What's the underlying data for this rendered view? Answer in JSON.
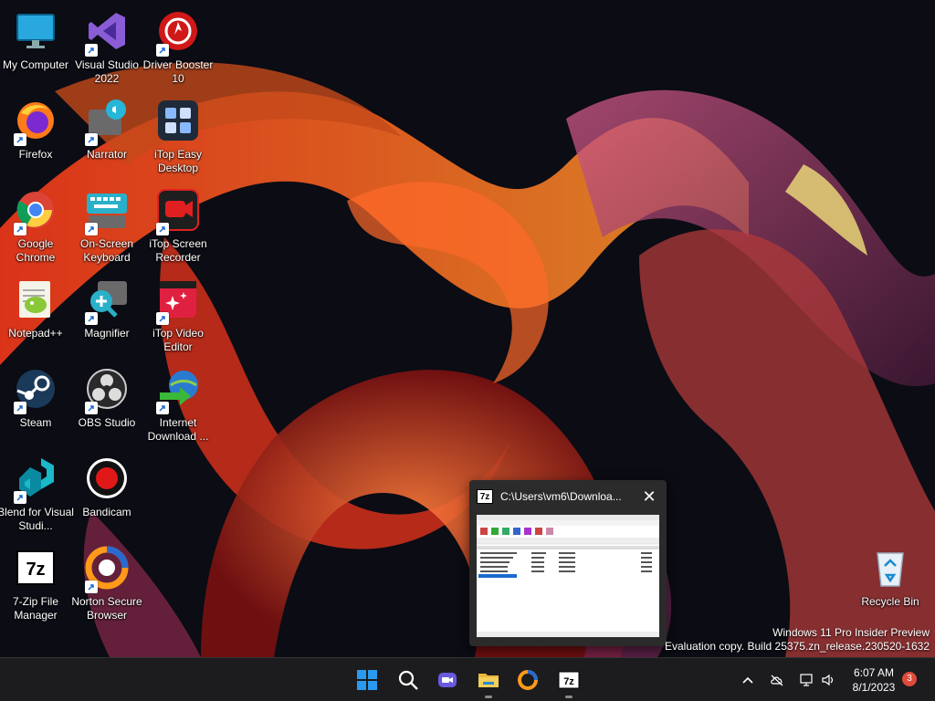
{
  "desktop": {
    "icons": [
      {
        "label": "My Computer",
        "icon": "monitor-icon",
        "shortcut": false
      },
      {
        "label": "Visual Studio 2022",
        "icon": "visual-studio-icon",
        "shortcut": true
      },
      {
        "label": "Driver Booster 10",
        "icon": "driver-booster-icon",
        "shortcut": true
      },
      {
        "label": "Firefox",
        "icon": "firefox-icon",
        "shortcut": true
      },
      {
        "label": "Narrator",
        "icon": "narrator-icon",
        "shortcut": true
      },
      {
        "label": "iTop Easy Desktop",
        "icon": "itop-easy-desktop-icon",
        "shortcut": true
      },
      {
        "label": "Google Chrome",
        "icon": "chrome-icon",
        "shortcut": true
      },
      {
        "label": "On-Screen Keyboard",
        "icon": "keyboard-icon",
        "shortcut": true
      },
      {
        "label": "iTop Screen Recorder",
        "icon": "itop-screen-recorder-icon",
        "shortcut": true
      },
      {
        "label": "Notepad++",
        "icon": "notepad-plus-plus-icon",
        "shortcut": true
      },
      {
        "label": "Magnifier",
        "icon": "magnifier-icon",
        "shortcut": true
      },
      {
        "label": "iTop Video Editor",
        "icon": "itop-video-editor-icon",
        "shortcut": true
      },
      {
        "label": "Steam",
        "icon": "steam-icon",
        "shortcut": true
      },
      {
        "label": "OBS Studio",
        "icon": "obs-icon",
        "shortcut": true
      },
      {
        "label": "Internet Download ...",
        "icon": "internet-download-manager-icon",
        "shortcut": true
      },
      {
        "label": "Blend for Visual Studi...",
        "icon": "blend-icon",
        "shortcut": true
      },
      {
        "label": "Bandicam",
        "icon": "bandicam-icon",
        "shortcut": true
      },
      {
        "label": "7-Zip File Manager",
        "icon": "seven-zip-icon",
        "shortcut": true
      },
      {
        "label": "Norton Secure Browser",
        "icon": "norton-browser-icon",
        "shortcut": true
      },
      {
        "label": "Recycle Bin",
        "icon": "recycle-bin-icon",
        "shortcut": false
      }
    ]
  },
  "preview": {
    "app_icon_text": "7z",
    "title": "C:\\Users\\vm6\\Downloa...",
    "close_glyph": "✕"
  },
  "watermark": {
    "line1": "Windows 11 Pro Insider Preview",
    "line2": "Evaluation copy. Build 25375.zn_release.230520-1632"
  },
  "taskbar": {
    "items": [
      {
        "icon": "start-icon",
        "running": false
      },
      {
        "icon": "search-icon",
        "running": false
      },
      {
        "icon": "teams-chat-icon",
        "running": false
      },
      {
        "icon": "file-explorer-icon",
        "running": true
      },
      {
        "icon": "norton-browser-icon",
        "running": false
      },
      {
        "icon": "seven-zip-icon",
        "running": true
      }
    ],
    "tray": [
      "chevron-up-icon",
      "cloud-off-icon",
      "network-icon",
      "volume-icon"
    ],
    "time": "6:07 AM",
    "date": "8/1/2023",
    "notification_count": "3"
  },
  "colors": {
    "taskbar_bg": "#1c1c1e",
    "wallpaper_base": "#0b0c14",
    "accent": "#0078d4",
    "notification_badge": "#e04a3a"
  }
}
